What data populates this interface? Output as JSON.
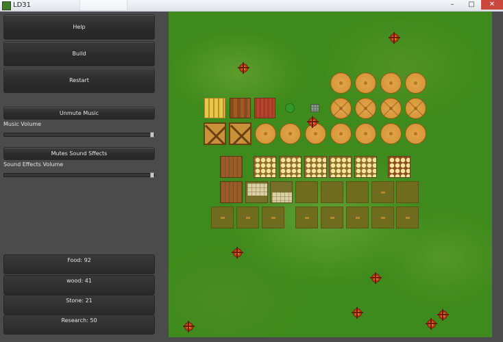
{
  "window": {
    "title": "LD31",
    "minimize": "–",
    "maximize": "□",
    "close": "✕"
  },
  "sidebar": {
    "help_label": "Help",
    "build_label": "Build",
    "restart_label": "Restart",
    "music_toggle_label": "Unmute Music",
    "music_volume_label": "Music Volume",
    "music_volume_value": 1.0,
    "sfx_toggle_label": "Mutes Sound Sffects",
    "sfx_volume_label": "Sound Effects Volume",
    "sfx_volume_value": 1.0
  },
  "resources": {
    "food": "Food: 92",
    "wood": "wood: 41",
    "stone": "Stone: 21",
    "research": "Research: 50"
  },
  "colors": {
    "panel": "#4b4b4b",
    "grass": "#3f8a1c",
    "button": "#2b2b2b",
    "text": "#e8e8e8"
  }
}
